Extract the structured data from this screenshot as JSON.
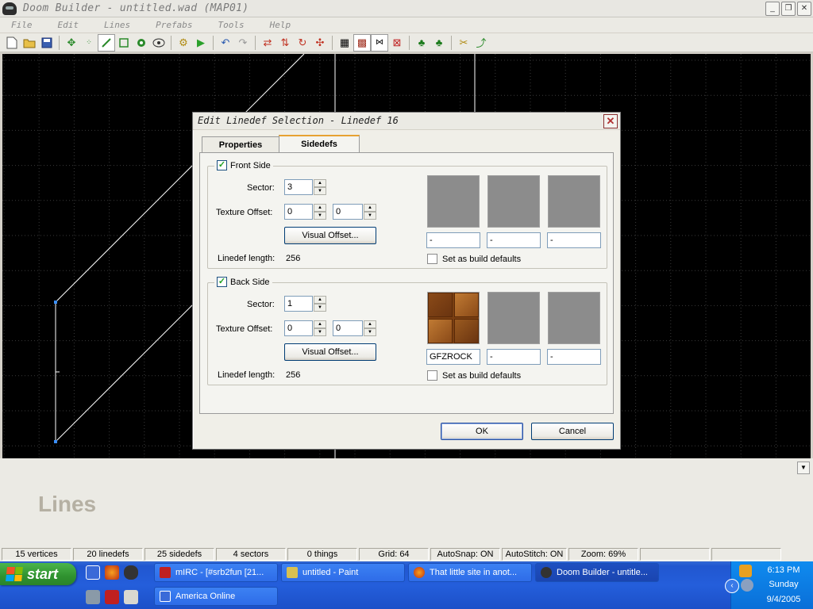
{
  "window": {
    "title": "Doom Builder - untitled.wad (MAP01)"
  },
  "menu": [
    "File",
    "Edit",
    "Lines",
    "Prefabs",
    "Tools",
    "Help"
  ],
  "toolbar": {
    "icons": [
      "new-file-icon",
      "open-folder-icon",
      "save-icon",
      "move-icon",
      "vertices-mode-icon",
      "lines-mode-icon",
      "sectors-mode-icon",
      "things-mode-icon",
      "3d-mode-icon",
      "test-map-icon",
      "play-icon",
      "undo-icon",
      "redo-icon",
      "flip-linedef-icon",
      "flip-sidedef-icon",
      "rotate-icon",
      "scale-icon",
      "grid-icon",
      "snap-grid-icon",
      "stitch-icon",
      "delete-icon",
      "tree-icon",
      "trees-icon",
      "tools-icon",
      "curve-icon"
    ]
  },
  "dialog": {
    "title": "Edit Linedef Selection - Linedef 16",
    "tabs": {
      "properties": "Properties",
      "sidedefs": "Sidedefs"
    },
    "front": {
      "label": "Front Side",
      "checked": true,
      "sector_label": "Sector:",
      "sector_value": "3",
      "offset_label": "Texture Offset:",
      "offset_x": "0",
      "offset_y": "0",
      "visual_offset": "Visual Offset...",
      "length_label": "Linedef length:",
      "length_value": "256",
      "tex_upper": "-",
      "tex_middle": "-",
      "tex_lower": "-",
      "build_defaults": "Set as build defaults"
    },
    "back": {
      "label": "Back Side",
      "checked": true,
      "sector_label": "Sector:",
      "sector_value": "1",
      "offset_label": "Texture Offset:",
      "offset_x": "0",
      "offset_y": "0",
      "visual_offset": "Visual Offset...",
      "length_label": "Linedef length:",
      "length_value": "256",
      "tex_upper": "GFZROCK",
      "tex_middle": "-",
      "tex_lower": "-",
      "build_defaults": "Set as build defaults"
    },
    "ok": "OK",
    "cancel": "Cancel"
  },
  "mode_label": "Lines",
  "status": {
    "vertices": "15 vertices",
    "linedefs": "20 linedefs",
    "sidedefs": "25 sidedefs",
    "sectors": "4 sectors",
    "things": "0 things",
    "grid": "Grid: 64",
    "autosnap": "AutoSnap: ON",
    "autostitch": "AutoStitch: ON",
    "zoom": "Zoom: 69%"
  },
  "taskbar": {
    "start": "start",
    "tasks": [
      {
        "label": "mIRC - [#srb2fun [21..."
      },
      {
        "label": "untitled - Paint"
      },
      {
        "label": "That little site in anot..."
      },
      {
        "label": "Doom Builder - untitle..."
      },
      {
        "label": "America  Online"
      }
    ],
    "clock": {
      "time": "6:13 PM",
      "day": "Sunday",
      "date": "9/4/2005"
    }
  },
  "colors": {
    "accent_tab": "#e7a132",
    "map_background": "#000000",
    "linedef": "#ffffff",
    "vertex": "#3a8fff"
  }
}
